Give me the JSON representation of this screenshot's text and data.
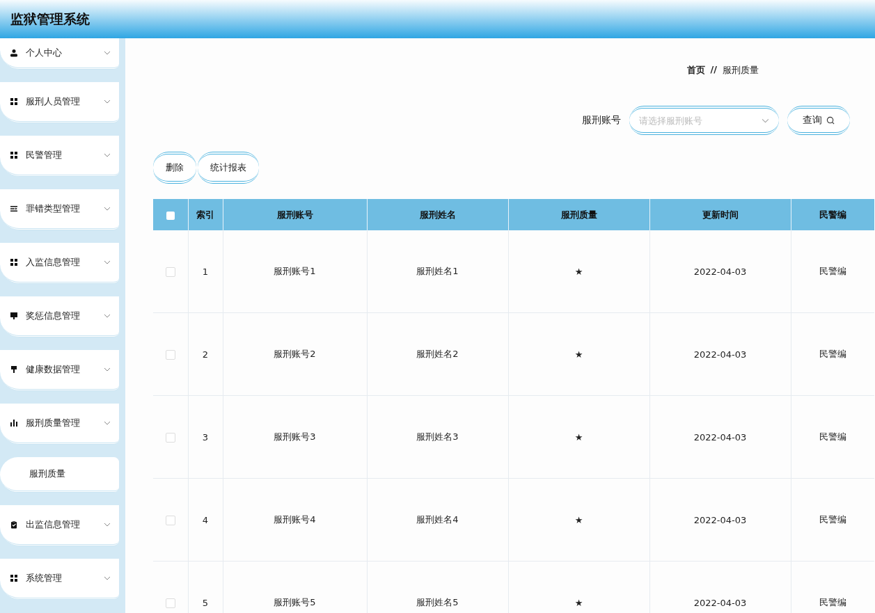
{
  "header": {
    "title": "监狱管理系统"
  },
  "sidebar": {
    "items": [
      {
        "label": "个人中心"
      },
      {
        "label": "服刑人员管理"
      },
      {
        "label": "民警管理"
      },
      {
        "label": "罪错类型管理"
      },
      {
        "label": "入监信息管理"
      },
      {
        "label": "奖惩信息管理"
      },
      {
        "label": "健康数据管理"
      },
      {
        "label": "服刑质量管理",
        "children": [
          {
            "label": "服刑质量"
          }
        ]
      },
      {
        "label": "出监信息管理"
      },
      {
        "label": "系统管理"
      }
    ]
  },
  "breadcrumb": {
    "home": "首页",
    "separator": "//",
    "current": "服刑质量"
  },
  "search": {
    "label": "服刑账号",
    "placeholder": "请选择服刑账号",
    "button": "查询"
  },
  "actions": [
    "删除",
    "统计报表"
  ],
  "table": {
    "select_all_checked": false,
    "columns": [
      "索引",
      "服刑账号",
      "服刑姓名",
      "服刑质量",
      "更新时间",
      "民警编"
    ],
    "rows": [
      {
        "checked": false,
        "cells": [
          "1",
          "服刑账号1",
          "服刑姓名1",
          "★",
          "2022-04-03",
          "民警编"
        ]
      },
      {
        "checked": false,
        "cells": [
          "2",
          "服刑账号2",
          "服刑姓名2",
          "★",
          "2022-04-03",
          "民警编"
        ]
      },
      {
        "checked": false,
        "cells": [
          "3",
          "服刑账号3",
          "服刑姓名3",
          "★",
          "2022-04-03",
          "民警编"
        ]
      },
      {
        "checked": false,
        "cells": [
          "4",
          "服刑账号4",
          "服刑姓名4",
          "★",
          "2022-04-03",
          "民警编"
        ]
      },
      {
        "checked": false,
        "cells": [
          "5",
          "服刑账号5",
          "服刑姓名5",
          "★",
          "2022-04-03",
          "民警编"
        ]
      }
    ]
  }
}
